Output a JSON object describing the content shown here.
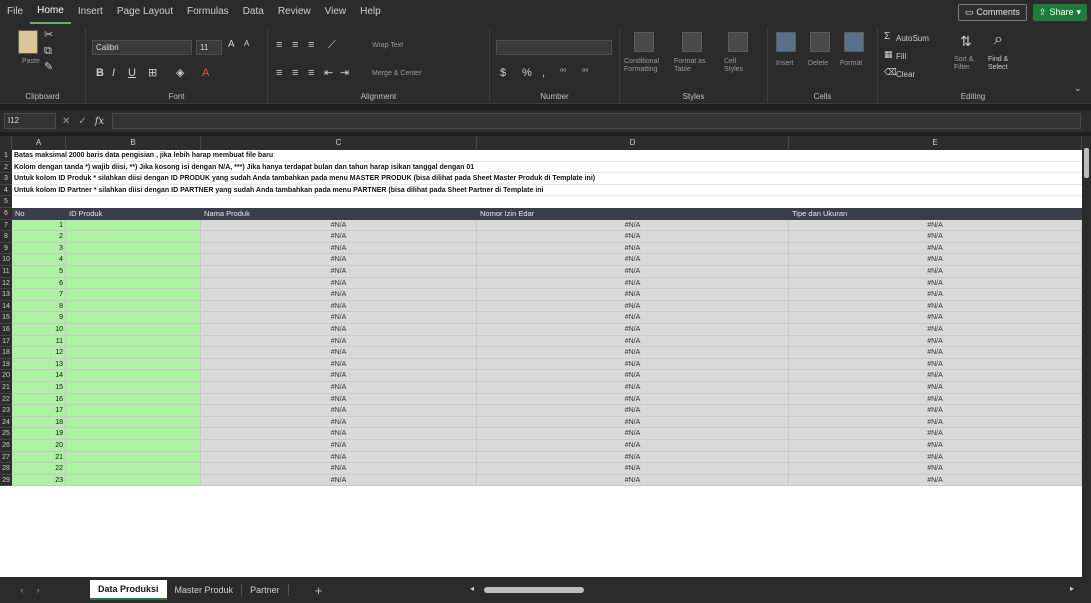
{
  "menubar": {
    "items": [
      "File",
      "Home",
      "Insert",
      "Page Layout",
      "Formulas",
      "Data",
      "Review",
      "View",
      "Help"
    ],
    "comments_label": "Comments",
    "share_label": "Share"
  },
  "ribbon": {
    "clipboard": {
      "label": "Clipboard",
      "paste": "Paste"
    },
    "font": {
      "label": "Font",
      "name": "Calibri",
      "size": "11"
    },
    "alignment": {
      "label": "Alignment",
      "wrap": "Wrap Text",
      "merge": "Merge & Center"
    },
    "number": {
      "label": "Number",
      "currency": "$",
      "percent": "%"
    },
    "styles": {
      "label": "Styles",
      "conditional": "Conditional Formatting",
      "format_table": "Format as Table",
      "cell_styles": "Cell Styles"
    },
    "cells": {
      "label": "Cells",
      "insert": "Insert",
      "delete": "Delete",
      "format": "Format"
    },
    "editing": {
      "label": "Editing",
      "autosum": "AutoSum",
      "fill": "Fill",
      "clear": "Clear",
      "sort": "Sort & Filter",
      "find": "Find & Select"
    }
  },
  "formula_bar": {
    "name_box": "I12",
    "fx": "fx"
  },
  "grid": {
    "columns": [
      "A",
      "B",
      "C",
      "D",
      "E"
    ],
    "notes": [
      "Batas maksimal 2000 baris data pengisian , jika lebih harap membuat file baru",
      "Kolom dengan tanda *) wajib diisi, **) Jika kosong isi dengan N/A, ***) Jika hanya terdapat bulan dan tahun harap isikan tanggal dengan 01",
      "Untuk kolom ID Produk * silahkan diisi dengan ID PRODUK yang sudah Anda tambahkan pada menu MASTER PRODUK (bisa dilihat pada Sheet Master Produk di Template ini)",
      "Untuk kolom ID Partner * silahkan diisi dengan ID PARTNER yang sudah Anda tambahkan pada menu PARTNER (bisa dilihat pada Sheet Partner di Template ini"
    ],
    "headers": {
      "no": "No",
      "id_produk": "ID Produk",
      "nama_produk": "Nama Produk",
      "nomor_izin": "Nomor Izin Edar",
      "tipe": "Tipe dan Ukuran"
    },
    "na_value": "#N/A",
    "rows": [
      1,
      2,
      3,
      4,
      5,
      6,
      7,
      8,
      9,
      10,
      11,
      12,
      13,
      14,
      15,
      16,
      17,
      18,
      19,
      20,
      21,
      22,
      23
    ]
  },
  "sheets": {
    "tabs": [
      "Data Produksi",
      "Master Produk",
      "Partner"
    ],
    "active": "Data Produksi"
  }
}
